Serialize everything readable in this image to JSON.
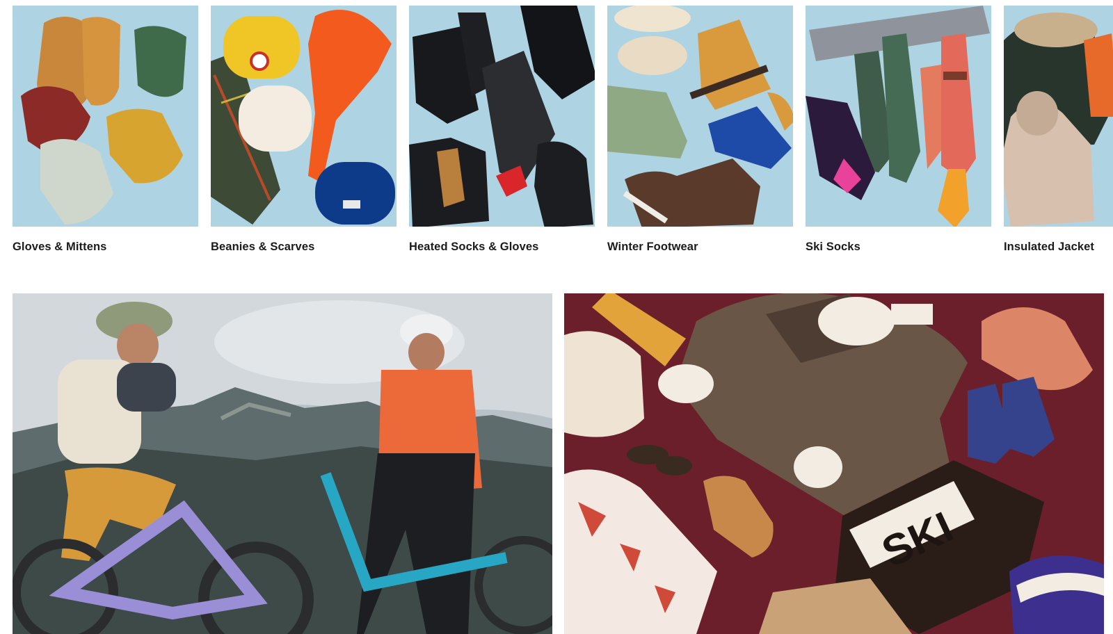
{
  "categories": [
    {
      "label": "Gloves & Mittens"
    },
    {
      "label": "Beanies & Scarves"
    },
    {
      "label": "Heated Socks & Gloves"
    },
    {
      "label": "Winter Footwear"
    },
    {
      "label": "Ski Socks"
    },
    {
      "label": "Insulated Jacket"
    }
  ],
  "colors": {
    "tile_background": "#a9cfe0",
    "label_text": "#1b1b1b",
    "promo_maroon": "#6b1f2a"
  },
  "promos": {
    "right": {
      "sweater_text": "SKI"
    }
  }
}
